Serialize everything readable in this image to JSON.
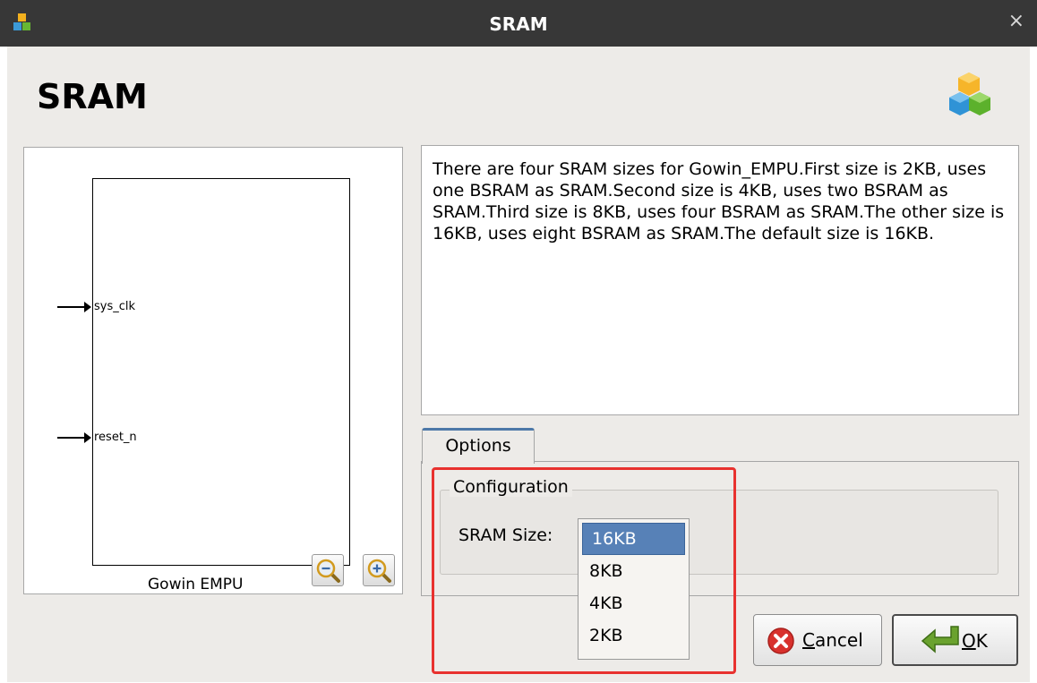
{
  "window": {
    "title": "SRAM",
    "close_glyph": "×"
  },
  "heading": "SRAM",
  "schematic": {
    "ports": [
      "sys_clk",
      "reset_n"
    ],
    "block_name": "Gowin EMPU",
    "zoom_out_icon": "zoom-out-icon",
    "zoom_in_icon": "zoom-in-icon"
  },
  "description": "There are four SRAM sizes for Gowin_EMPU.First size is 2KB, uses one BSRAM as SRAM.Second size is 4KB, uses two BSRAM as SRAM.Third size is 8KB, uses four BSRAM as SRAM.The other size is 16KB, uses eight BSRAM as SRAM.The default size is 16KB.",
  "tabs": {
    "options_label": "Options"
  },
  "configuration": {
    "group_label": "Configuration",
    "sram_size_label": "SRAM Size:",
    "selected": "16KB",
    "options": [
      "16KB",
      "8KB",
      "4KB",
      "2KB"
    ]
  },
  "buttons": {
    "cancel_mnemonic": "C",
    "cancel_rest": "ancel",
    "ok_mnemonic": "O",
    "ok_rest": "K"
  },
  "colors": {
    "titlebar": "#373737",
    "selection": "#5781b7",
    "highlight": "#e8322f",
    "tab_accent": "#4d78a8"
  }
}
